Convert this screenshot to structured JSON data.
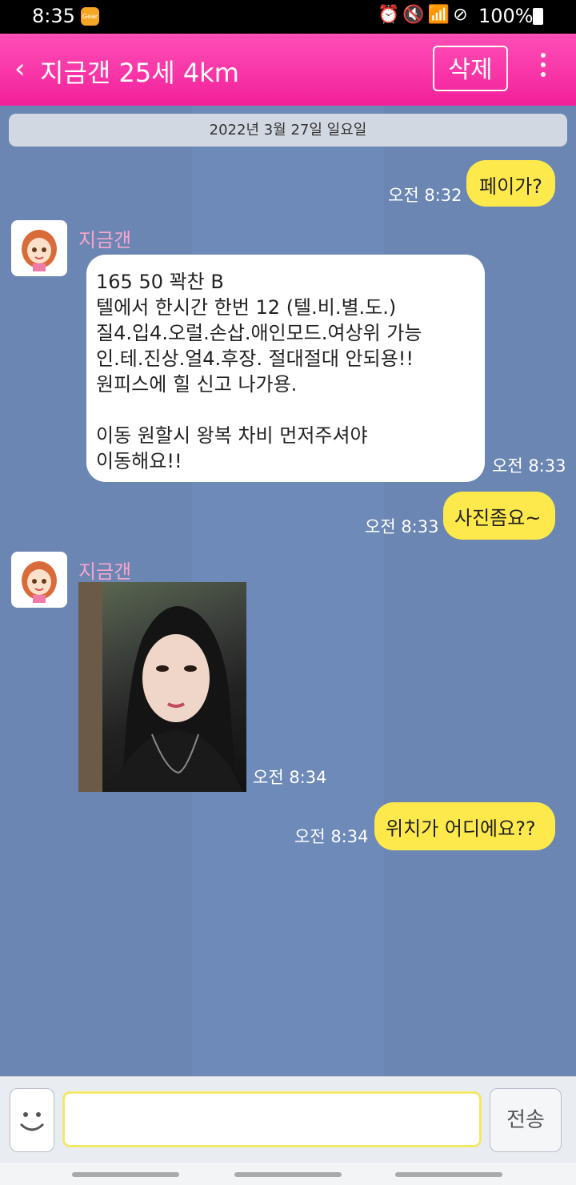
{
  "status_bar": {
    "time": "8:35",
    "gear_badge": "Gear",
    "battery": "100%"
  },
  "header": {
    "back_icon": "‹",
    "title": "지금갠 25세 4km",
    "delete_label": "삭제"
  },
  "date_divider": "2022년 3월 27일 일요일",
  "messages": [
    {
      "from": "me",
      "text": "페이가?",
      "time": "오전 8:32"
    },
    {
      "from": "them",
      "sender": "지금갠",
      "lines": [
        "165 50 꽉찬 B",
        "텔에서 한시간 한번 12 (텔.비.별.도.)",
        "질4.입4.오럴.손삽.애인모드.여상위 가능",
        "인.테.진상.얼4.후장. 절대절대 안되용!!",
        "원피스에 힐 신고 나가용.",
        "",
        "이동 원할시 왕복 차비 먼저주셔야",
        "이동해요!!"
      ],
      "time": "오전 8:33"
    },
    {
      "from": "me",
      "text": "사진좀요~",
      "time": "오전 8:33"
    },
    {
      "from": "them",
      "sender": "지금갠",
      "type": "photo",
      "time": "오전 8:34"
    },
    {
      "from": "me",
      "text": "위치가 어디에요??",
      "time": "오전 8:34"
    }
  ],
  "composer": {
    "input_value": "",
    "send_label": "전송",
    "emoji_icon": "smiley-icon"
  },
  "colors": {
    "header": "#f2209a",
    "my_bubble": "#fde94c",
    "chat_bg": "#6f8ab5",
    "sender_name": "#f6a6cf"
  }
}
